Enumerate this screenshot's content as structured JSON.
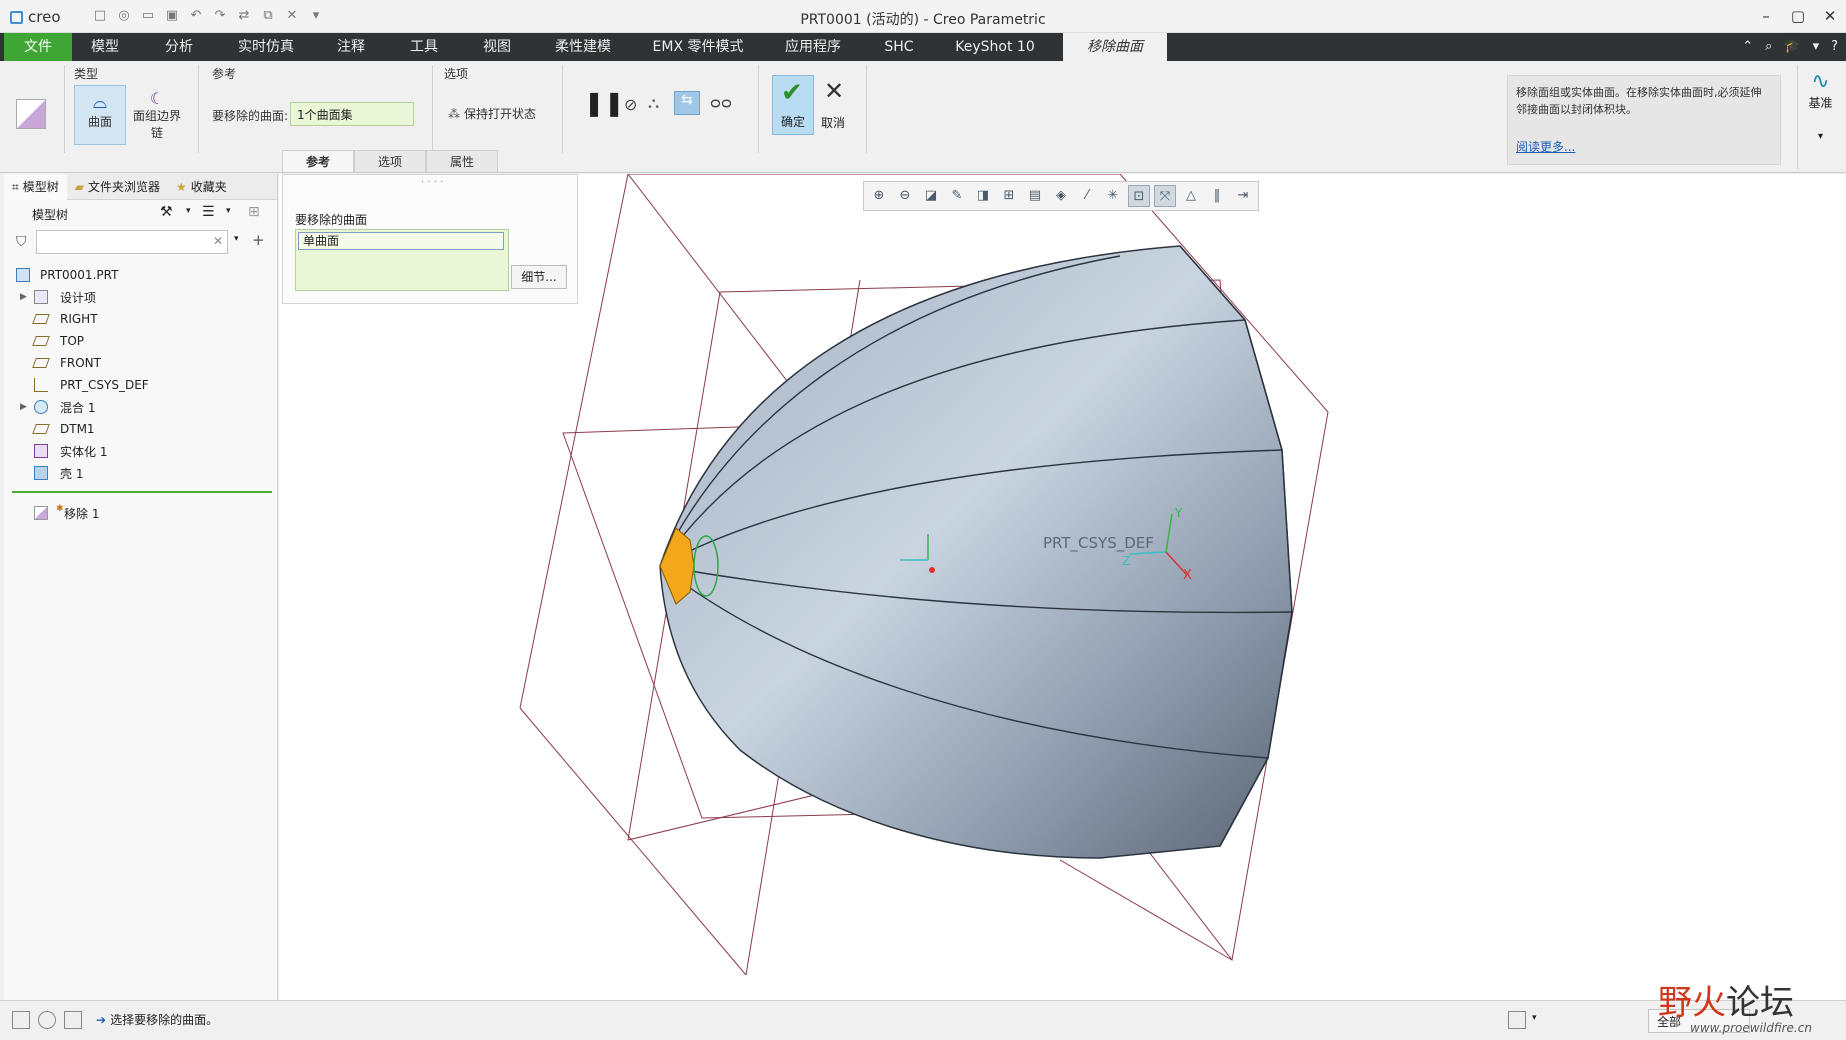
{
  "app": {
    "logo": "creo",
    "title": "PRT0001 (活动的) - Creo Parametric"
  },
  "ribbon_tabs": [
    {
      "label": "文件"
    },
    {
      "label": "模型"
    },
    {
      "label": "分析"
    },
    {
      "label": "实时仿真"
    },
    {
      "label": "注释"
    },
    {
      "label": "工具"
    },
    {
      "label": "视图"
    },
    {
      "label": "柔性建模"
    },
    {
      "label": "EMX 零件模式"
    },
    {
      "label": "应用程序"
    },
    {
      "label": "SHC"
    },
    {
      "label": "KeyShot 10"
    },
    {
      "label": "移除曲面"
    }
  ],
  "ribbon": {
    "type_group": "类型",
    "type_surface": "曲面",
    "type_boundary": "面组边界链",
    "ref_group": "参考",
    "ref_label": "要移除的曲面:",
    "ref_value": "1个曲面集",
    "options_group": "选项",
    "keep_open": "保持打开状态",
    "ok": "确定",
    "cancel": "取消",
    "sub_tabs": [
      "参考",
      "选项",
      "属性"
    ],
    "info_text": "移除面组或实体曲面。在移除实体曲面时,必须延伸邻接曲面以封闭体积块。",
    "read_more": "阅读更多...",
    "datum": "基准"
  },
  "left_panel": {
    "tabs": [
      "模型树",
      "文件夹浏览器",
      "收藏夹"
    ],
    "tree_title": "模型树",
    "items": [
      {
        "label": "PRT0001.PRT",
        "icon": "part-icon"
      },
      {
        "label": "设计项",
        "icon": "design-items-icon"
      },
      {
        "label": "RIGHT",
        "icon": "datum-plane-icon"
      },
      {
        "label": "TOP",
        "icon": "datum-plane-icon"
      },
      {
        "label": "FRONT",
        "icon": "datum-plane-icon"
      },
      {
        "label": "PRT_CSYS_DEF",
        "icon": "csys-icon"
      },
      {
        "label": "混合 1",
        "icon": "blend-icon"
      },
      {
        "label": "DTM1",
        "icon": "datum-plane-icon"
      },
      {
        "label": "实体化 1",
        "icon": "solidify-icon"
      },
      {
        "label": "壳 1",
        "icon": "shell-icon"
      },
      {
        "label": "移除 1",
        "icon": "remove-icon"
      }
    ]
  },
  "collector": {
    "header": "要移除的曲面",
    "item": "单曲面",
    "details": "细节..."
  },
  "viewport": {
    "csys_label": "PRT_CSYS_DEF",
    "x_axis": "X",
    "y_axis": "Y",
    "z_axis": "Z"
  },
  "status": {
    "message": "选择要移除的曲面。",
    "filter": "全部",
    "watermark_red": "野火",
    "watermark_dark": "论坛",
    "watermark_url": "www.proewildfire.cn"
  },
  "colors": {
    "file_tab": "#3fa535",
    "tab_bar": "#2f3336",
    "surface_fill": "#8f9fb3",
    "selected_surface": "#f3a81c",
    "datum_plane": "#8b3a4a"
  }
}
